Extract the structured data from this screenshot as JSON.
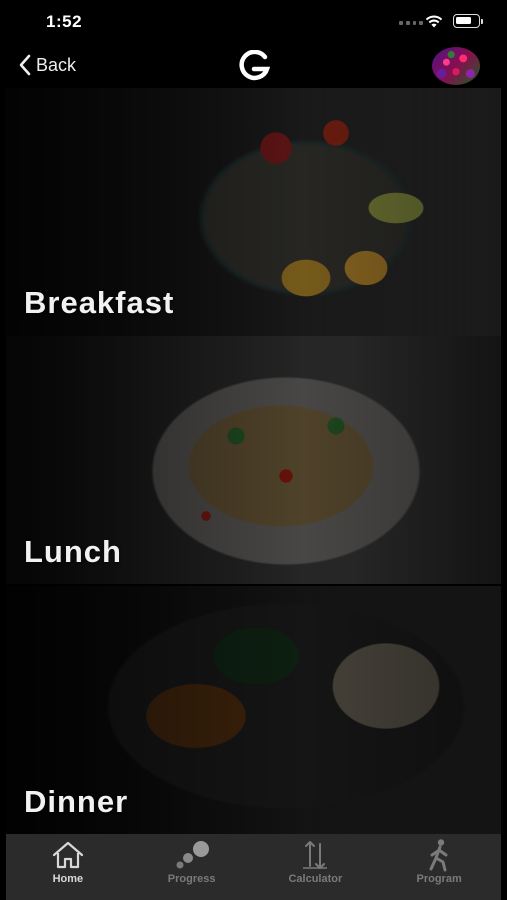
{
  "status_bar": {
    "time": "1:52",
    "battery_level": 0.75
  },
  "nav": {
    "back_label": "Back",
    "logo_letter": "G"
  },
  "meals": [
    {
      "id": "breakfast",
      "title": "Breakfast"
    },
    {
      "id": "lunch",
      "title": "Lunch"
    },
    {
      "id": "dinner",
      "title": "Dinner"
    }
  ],
  "tabs": [
    {
      "id": "home",
      "label": "Home",
      "icon": "home-icon",
      "active": true
    },
    {
      "id": "progress",
      "label": "Progress",
      "icon": "progress-dots-icon",
      "active": false
    },
    {
      "id": "calculator",
      "label": "Calculator",
      "icon": "calculator-arrows-icon",
      "active": false
    },
    {
      "id": "program",
      "label": "Program",
      "icon": "walking-person-icon",
      "active": false
    }
  ],
  "colors": {
    "tab_bar_bg": "#2b2b2b",
    "active_tab": "#d8d8d8",
    "inactive_tab": "#7a7a7a"
  }
}
